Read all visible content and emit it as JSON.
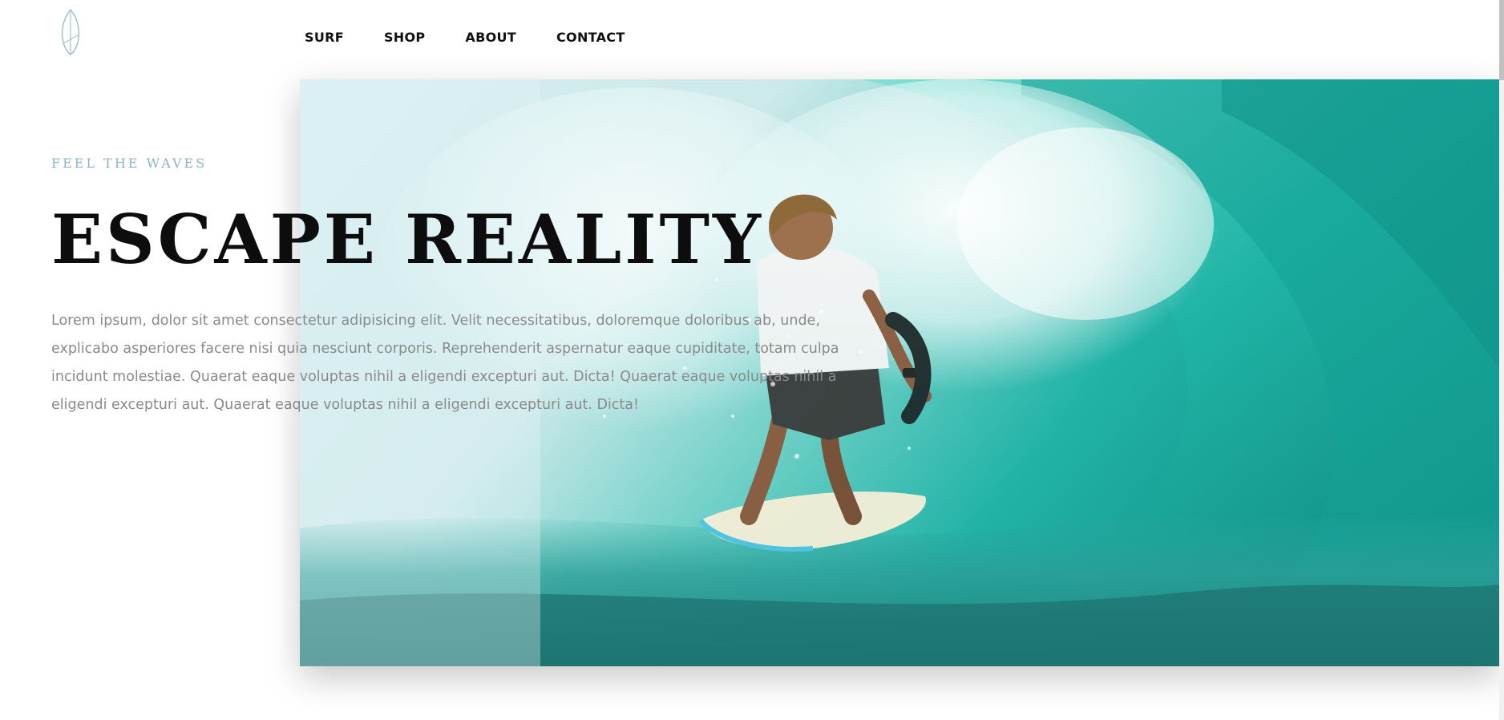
{
  "brand": {
    "logo_icon": "surfboard-icon",
    "logo_color": "#8fb2c9"
  },
  "nav": {
    "items": [
      "SURF",
      "SHOP",
      "ABOUT",
      "CONTACT"
    ]
  },
  "hero": {
    "eyebrow": "FEEL THE WAVES",
    "headline": "ESCAPE REALITY",
    "body": "Lorem ipsum, dolor sit amet consectetur adipisicing elit. Velit necessitatibus, doloremque doloribus ab, unde, explicabo asperiores facere nisi quia nesciunt corporis. Reprehenderit aspernatur eaque cupiditate, totam culpa incidunt molestiae. Quaerat eaque voluptas nihil a eligendi excepturi aut. Dicta! Quaerat eaque voluptas nihil a eligendi excepturi aut. Quaerat eaque voluptas nihil a eligendi excepturi aut. Dicta!",
    "image_subject": "surfer-in-wave-barrel"
  },
  "colors": {
    "accent": "#8fb2c9",
    "headline": "#0d0d0d",
    "body_text": "#8a8a8a",
    "water_light": "#bfe9ea",
    "water_dark": "#1a9d96"
  }
}
